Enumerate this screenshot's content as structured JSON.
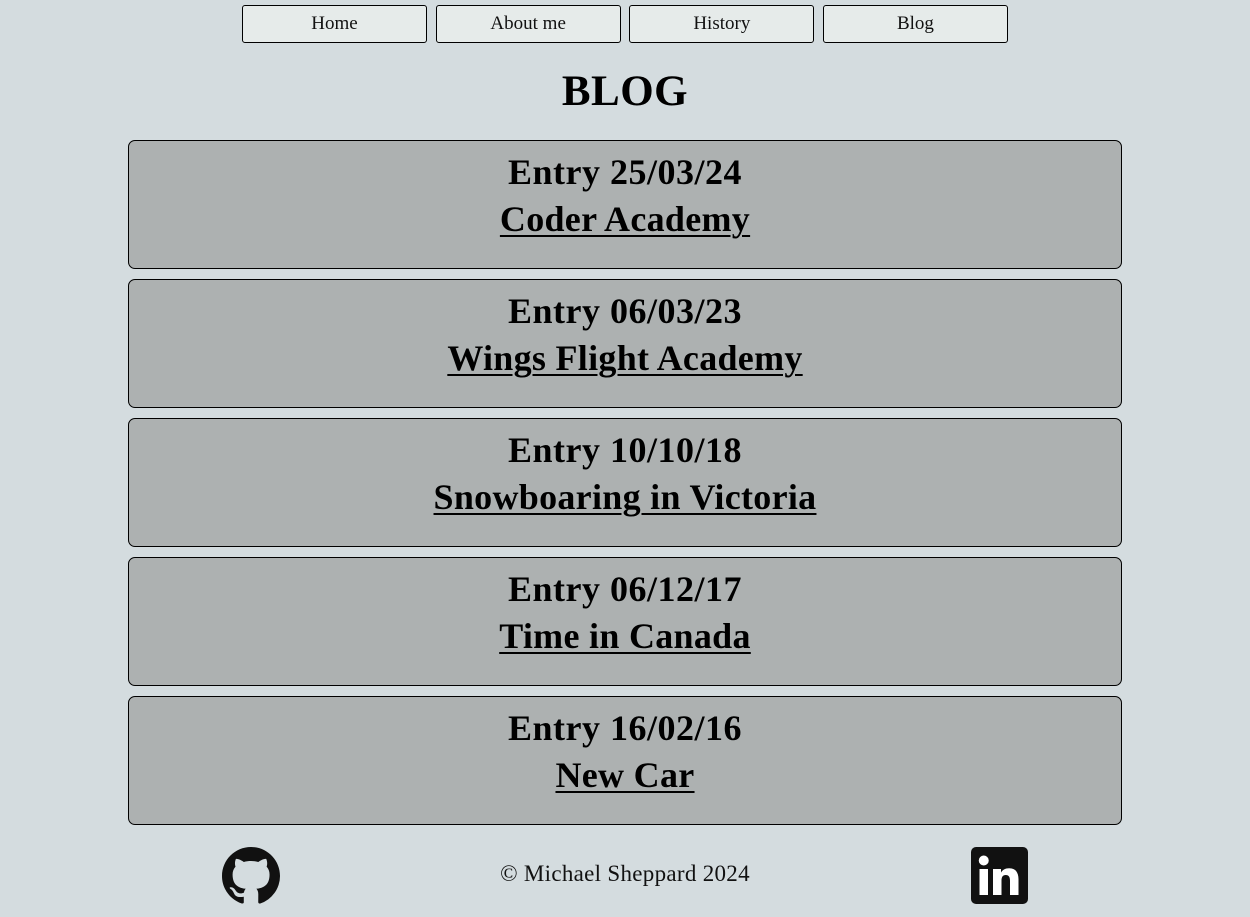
{
  "nav": {
    "items": [
      {
        "label": "Home"
      },
      {
        "label": "About me"
      },
      {
        "label": "History"
      },
      {
        "label": "Blog"
      }
    ]
  },
  "page": {
    "title": "BLOG"
  },
  "entries": [
    {
      "date": "Entry 25/03/24",
      "link": "Coder Academy"
    },
    {
      "date": "Entry 06/03/23",
      "link": "Wings Flight Academy"
    },
    {
      "date": "Entry 10/10/18",
      "link": "Snowboaring in Victoria"
    },
    {
      "date": "Entry 06/12/17",
      "link": "Time in Canada"
    },
    {
      "date": "Entry 16/02/16",
      "link": "New Car"
    }
  ],
  "footer": {
    "copyright": "© Michael Sheppard 2024",
    "icons": [
      "github-icon",
      "linkedin-icon"
    ]
  },
  "colors": {
    "page_background": "#d4dcdf",
    "card_background": "#adb1b1",
    "nav_button_background": "#e6ebea",
    "text": "#000000"
  }
}
